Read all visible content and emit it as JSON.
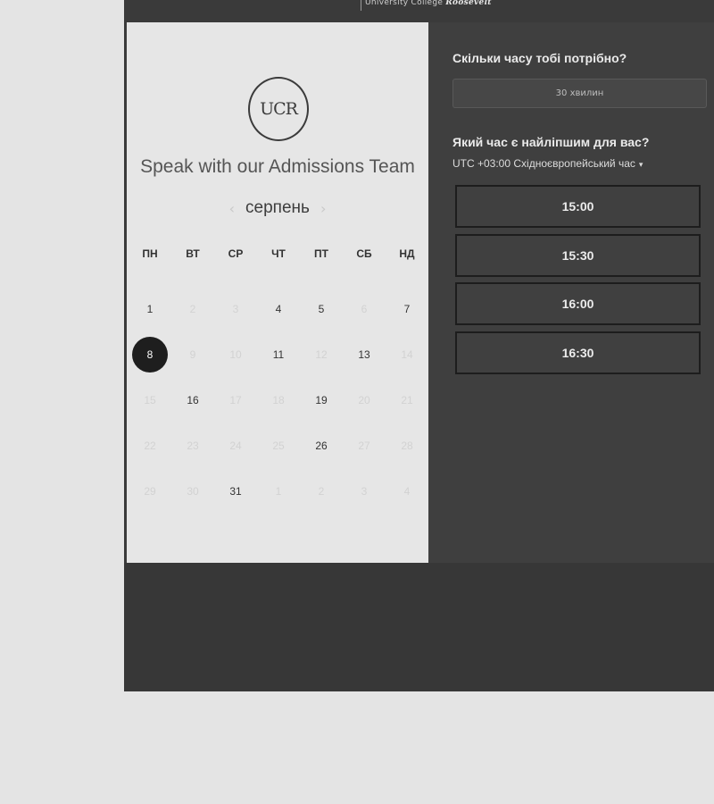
{
  "header": {
    "brand_line1": "University College",
    "brand_line2": "Roosevelt"
  },
  "left": {
    "logo_text": "UCR",
    "title": "Speak with our Admissions Team",
    "month": "серпень",
    "prev_icon": "‹",
    "next_icon": "›",
    "weekdays": [
      "ПН",
      "ВТ",
      "СР",
      "ЧТ",
      "ПТ",
      "СБ",
      "НД"
    ],
    "days": [
      {
        "d": "1",
        "s": "on"
      },
      {
        "d": "2",
        "s": "off"
      },
      {
        "d": "3",
        "s": "off"
      },
      {
        "d": "4",
        "s": "on"
      },
      {
        "d": "5",
        "s": "on"
      },
      {
        "d": "6",
        "s": "off"
      },
      {
        "d": "7",
        "s": "on"
      },
      {
        "d": "8",
        "s": "sel"
      },
      {
        "d": "9",
        "s": "off"
      },
      {
        "d": "10",
        "s": "off"
      },
      {
        "d": "11",
        "s": "on"
      },
      {
        "d": "12",
        "s": "off"
      },
      {
        "d": "13",
        "s": "on"
      },
      {
        "d": "14",
        "s": "off"
      },
      {
        "d": "15",
        "s": "off"
      },
      {
        "d": "16",
        "s": "on"
      },
      {
        "d": "17",
        "s": "off"
      },
      {
        "d": "18",
        "s": "off"
      },
      {
        "d": "19",
        "s": "on"
      },
      {
        "d": "20",
        "s": "off"
      },
      {
        "d": "21",
        "s": "off"
      },
      {
        "d": "22",
        "s": "off"
      },
      {
        "d": "23",
        "s": "off"
      },
      {
        "d": "24",
        "s": "off"
      },
      {
        "d": "25",
        "s": "off"
      },
      {
        "d": "26",
        "s": "on"
      },
      {
        "d": "27",
        "s": "off"
      },
      {
        "d": "28",
        "s": "off"
      },
      {
        "d": "29",
        "s": "off"
      },
      {
        "d": "30",
        "s": "off"
      },
      {
        "d": "31",
        "s": "on"
      },
      {
        "d": "1",
        "s": "off"
      },
      {
        "d": "2",
        "s": "off"
      },
      {
        "d": "3",
        "s": "off"
      },
      {
        "d": "4",
        "s": "off"
      }
    ]
  },
  "right": {
    "q_duration": "Скільки часу тобі потрібно?",
    "duration_value": "30 хвилин",
    "q_time": "Який час є найліпшим для вас?",
    "timezone": "UTC +03:00 Східноєвропейський час",
    "timezone_caret": "▾",
    "slots": [
      "15:00",
      "15:30",
      "16:00",
      "16:30"
    ]
  }
}
